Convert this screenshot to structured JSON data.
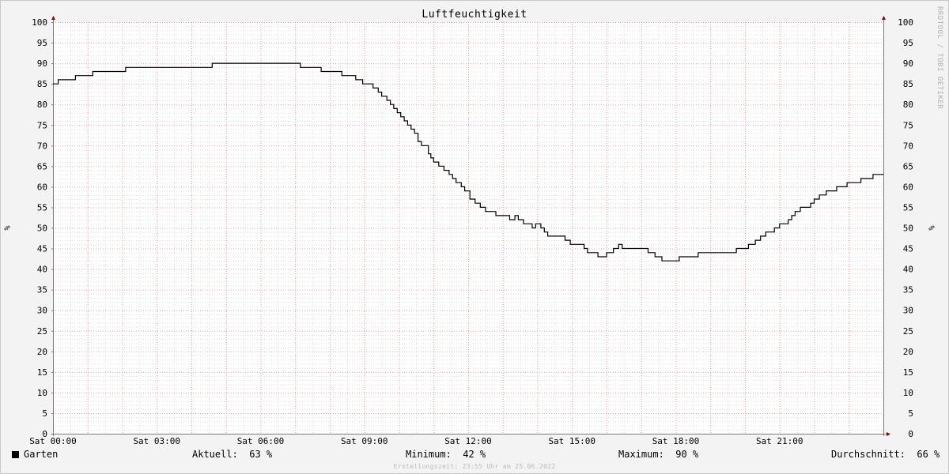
{
  "chart_data": {
    "type": "line",
    "title": "Luftfeuchtigkeit",
    "ylabel": "%",
    "ylim": [
      0,
      100
    ],
    "y_ticks": [
      0,
      5,
      10,
      15,
      20,
      25,
      30,
      35,
      40,
      45,
      50,
      55,
      60,
      65,
      70,
      75,
      80,
      85,
      90,
      95,
      100
    ],
    "x_ticks": [
      {
        "hour": 0,
        "label": "Sat 00:00"
      },
      {
        "hour": 3,
        "label": "Sat 03:00"
      },
      {
        "hour": 6,
        "label": "Sat 06:00"
      },
      {
        "hour": 9,
        "label": "Sat 09:00"
      },
      {
        "hour": 12,
        "label": "Sat 12:00"
      },
      {
        "hour": 15,
        "label": "Sat 15:00"
      },
      {
        "hour": 18,
        "label": "Sat 18:00"
      },
      {
        "hour": 21,
        "label": "Sat 21:00"
      }
    ],
    "xlim_hours": [
      0,
      24
    ],
    "grid": true,
    "series": [
      {
        "name": "Garten",
        "color": "#000000",
        "points": [
          [
            0.0,
            85
          ],
          [
            0.15,
            86
          ],
          [
            0.65,
            87
          ],
          [
            1.15,
            88
          ],
          [
            2.1,
            89
          ],
          [
            4.6,
            90
          ],
          [
            7.15,
            89
          ],
          [
            7.75,
            88
          ],
          [
            8.35,
            87
          ],
          [
            8.75,
            86
          ],
          [
            8.95,
            85
          ],
          [
            9.25,
            84
          ],
          [
            9.4,
            83
          ],
          [
            9.5,
            82
          ],
          [
            9.65,
            81
          ],
          [
            9.75,
            80
          ],
          [
            9.85,
            79
          ],
          [
            9.95,
            78
          ],
          [
            10.05,
            77
          ],
          [
            10.15,
            76
          ],
          [
            10.25,
            75
          ],
          [
            10.35,
            74
          ],
          [
            10.45,
            73
          ],
          [
            10.55,
            71
          ],
          [
            10.65,
            70
          ],
          [
            10.85,
            68
          ],
          [
            10.92,
            67
          ],
          [
            11.0,
            66
          ],
          [
            11.15,
            65
          ],
          [
            11.3,
            64
          ],
          [
            11.45,
            63
          ],
          [
            11.55,
            62
          ],
          [
            11.65,
            61
          ],
          [
            11.8,
            60
          ],
          [
            11.9,
            59
          ],
          [
            12.05,
            57
          ],
          [
            12.2,
            56
          ],
          [
            12.35,
            55
          ],
          [
            12.5,
            54
          ],
          [
            12.8,
            53
          ],
          [
            13.2,
            52
          ],
          [
            13.35,
            53
          ],
          [
            13.45,
            52
          ],
          [
            13.6,
            51
          ],
          [
            13.85,
            50
          ],
          [
            13.95,
            51
          ],
          [
            14.1,
            50
          ],
          [
            14.2,
            49
          ],
          [
            14.3,
            48
          ],
          [
            14.8,
            47
          ],
          [
            14.95,
            46
          ],
          [
            15.35,
            45
          ],
          [
            15.45,
            44
          ],
          [
            15.75,
            43
          ],
          [
            16.0,
            44
          ],
          [
            16.2,
            45
          ],
          [
            16.35,
            46
          ],
          [
            16.45,
            45
          ],
          [
            17.2,
            44
          ],
          [
            17.4,
            43
          ],
          [
            17.6,
            42
          ],
          [
            18.1,
            43
          ],
          [
            18.65,
            44
          ],
          [
            19.75,
            45
          ],
          [
            20.1,
            46
          ],
          [
            20.3,
            47
          ],
          [
            20.45,
            48
          ],
          [
            20.6,
            49
          ],
          [
            20.85,
            50
          ],
          [
            21.0,
            51
          ],
          [
            21.25,
            52
          ],
          [
            21.35,
            53
          ],
          [
            21.45,
            54
          ],
          [
            21.6,
            55
          ],
          [
            21.9,
            56
          ],
          [
            22.0,
            57
          ],
          [
            22.15,
            58
          ],
          [
            22.35,
            59
          ],
          [
            22.65,
            60
          ],
          [
            22.95,
            61
          ],
          [
            23.35,
            62
          ],
          [
            23.7,
            63
          ],
          [
            24.0,
            63
          ]
        ]
      }
    ]
  },
  "side_watermark": "RRDTOOL / TOBI OETIKER",
  "legend": {
    "series_name": "Garten",
    "current_label": "Aktuell:",
    "current_value": "63 %",
    "min_label": "Minimum:",
    "min_value": "42 %",
    "max_label": "Maximum:",
    "max_value": "90 %",
    "avg_label": "Durchschnitt:",
    "avg_value": "66 %"
  },
  "footer": "Erstellungszeit: 23:55 Uhr am 25.06.2022",
  "colors": {
    "grid_minor": "#dcdcdc",
    "grid_major": "#e8a0a0",
    "axis": "#7a7a7a",
    "arrow": "#8b0000",
    "line": "#000000"
  }
}
